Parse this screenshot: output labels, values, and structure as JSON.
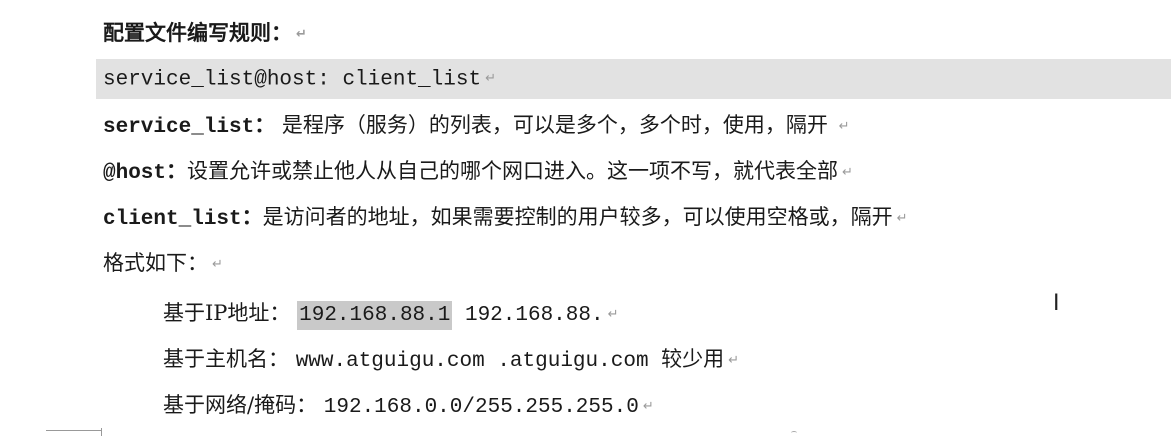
{
  "heading": "配置文件编写规则：",
  "syntax_line": "service_list@host: client_list",
  "definitions": [
    {
      "term": "service_list：",
      "description": " 是程序（服务）的列表，可以是多个，多个时，使用，隔开 "
    },
    {
      "term": "@host：",
      "description": "设置允许或禁止他人从自己的哪个网口进入。这一项不写，就代表全部"
    },
    {
      "term": "client_list：",
      "description": "是访问者的地址，如果需要控制的用户较多，可以使用空格或，隔开"
    }
  ],
  "format_heading": "格式如下：",
  "formats": [
    {
      "label": "基于IP地址：",
      "highlighted": "192.168.88.1",
      "value": " 192.168.88."
    },
    {
      "label": "基于主机名：",
      "value": "www.atguigu.com .atguigu.com 较少用"
    },
    {
      "label": "基于网络/掩码：",
      "value": "192.168.0.0/255.255.255.0"
    }
  ],
  "paragraph_mark": "↵",
  "cursor_glyph": "I",
  "icons": [
    "text-cursor-icon",
    "paragraph-mark-icon"
  ],
  "colors": {
    "text": "#1a1a1a",
    "code_block_shading": "#e2e2e2",
    "selection_highlight": "#c9c9c9",
    "paragraph_mark": "#9a9a9a"
  }
}
